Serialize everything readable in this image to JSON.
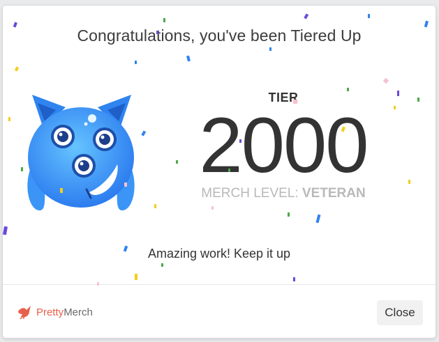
{
  "modal": {
    "title": "Congratulations, you've been Tiered Up",
    "tier_label": "TIER",
    "tier_number": "2000",
    "merch_level_prefix": "MERCH LEVEL: ",
    "merch_level_value": "VETERAN",
    "message": "Amazing work! Keep it up"
  },
  "footer": {
    "brand_part1": "Pretty",
    "brand_part2": "Merch",
    "close_label": "Close"
  },
  "colors": {
    "monster_blue": "#2f8cf4",
    "brand_red": "#e8604c"
  }
}
